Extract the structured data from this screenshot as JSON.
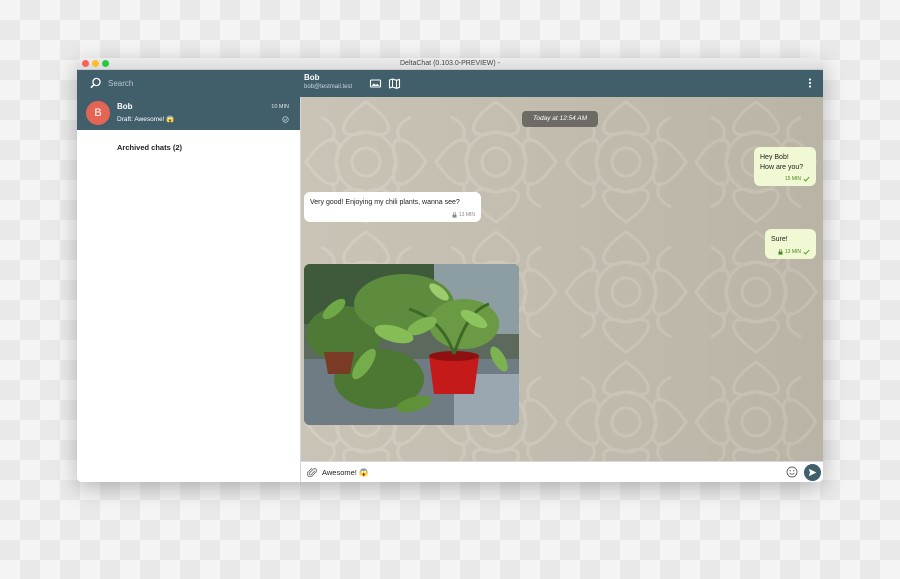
{
  "window": {
    "title": "DeltaChat (0.103.0-PREVIEW) -"
  },
  "search": {
    "placeholder": "Search"
  },
  "header": {
    "contact_name": "Bob",
    "contact_email": "bob@testmail.test"
  },
  "sidebar": {
    "chats": [
      {
        "avatar_letter": "B",
        "name": "Bob",
        "time": "10 MIN",
        "draft": "Draft: Awesome! 😱",
        "avatar_color": "#e56555"
      }
    ],
    "archived_label": "Archived chats (2)"
  },
  "messages": {
    "date_separator": "Today at 12:54 AM",
    "items": [
      {
        "direction": "outgoing",
        "lines": [
          "Hey Bob!",
          "How are you?"
        ],
        "time": "15 MIN",
        "status": "delivered"
      },
      {
        "direction": "incoming",
        "text": "Very good! Enjoying my chili plants, wanna see?",
        "time": "13 MIN",
        "encrypted": true
      },
      {
        "direction": "outgoing",
        "text": "Sure!",
        "time": "13 MIN",
        "encrypted": true,
        "status": "delivered"
      },
      {
        "direction": "incoming",
        "type": "image",
        "description": "photo of potted chili plants"
      }
    ]
  },
  "composer": {
    "value": "Awesome! 😱"
  },
  "icons": {
    "search": "search-icon",
    "gallery": "gallery-icon",
    "map": "map-icon",
    "menu": "kebab-menu-icon",
    "attach": "paperclip-icon",
    "emoji": "emoji-icon",
    "send": "send-icon",
    "lock": "lock-icon",
    "check": "check-icon"
  },
  "colors": {
    "header": "#415e6b",
    "outgoing_bubble": "#f0f8d4",
    "incoming_bubble": "#ffffff",
    "accent_check": "#4a8a1a"
  }
}
